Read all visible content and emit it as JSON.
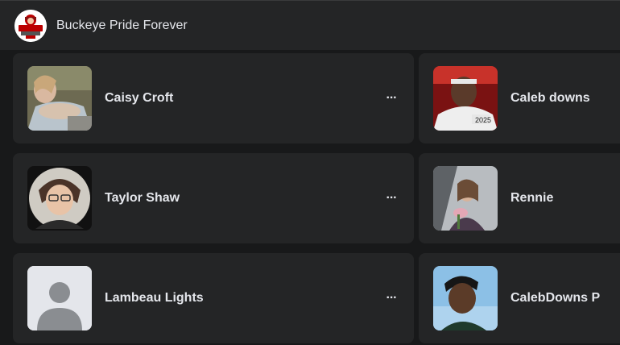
{
  "header": {
    "group_name": "Buckeye Pride Forever",
    "avatar_icon": "ohio-state-logo"
  },
  "members": [
    {
      "name": "Caisy Croft",
      "more_label": "···"
    },
    {
      "name": "Caleb downs"
    },
    {
      "name": "Taylor Shaw",
      "more_label": "···"
    },
    {
      "name": "Rennie"
    },
    {
      "name": "Lambeau Lights",
      "more_label": "···"
    },
    {
      "name": "CalebDowns P"
    }
  ],
  "colors": {
    "background": "#18191a",
    "card": "#242526",
    "text": "#e4e6eb",
    "ohio_state_scarlet": "#bb0000"
  }
}
